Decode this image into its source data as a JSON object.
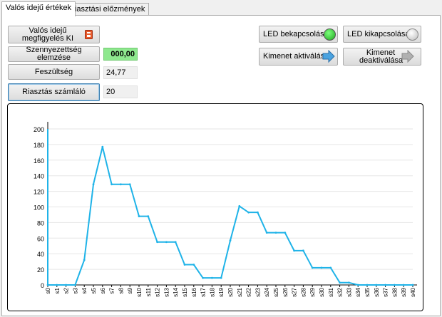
{
  "tabs": [
    {
      "label": "Valós idejű értékek",
      "active": true
    },
    {
      "label": "Riasztási előzmények",
      "active": false
    }
  ],
  "buttons": {
    "realtime_monitoring": "Valós idejű megfigyelés KI",
    "contamination_analysis": "Szennyezettség elemzése",
    "voltage": "Feszültség",
    "alarm_counter": "Riasztás számláló",
    "led_on": "LED bekapcsolása",
    "led_off": "LED kikapcsolása",
    "output_activate": "Kimenet aktiválása",
    "output_deactivate": "Kimenet deaktiválása"
  },
  "fields": {
    "contamination_value": "000,00",
    "voltage_value": "24,77",
    "alarm_count": "20"
  },
  "colors": {
    "led_on": "#22c022",
    "led_off": "#cfcfcf",
    "series": "#1fb3e8",
    "arrow_active": "#4aa3e0",
    "arrow_inactive": "#b0b0b0"
  },
  "chart_data": {
    "type": "line",
    "title": "",
    "xlabel": "",
    "ylabel": "",
    "ylim": [
      0,
      200
    ],
    "yticks": [
      0,
      20,
      40,
      60,
      80,
      100,
      120,
      140,
      160,
      180,
      200
    ],
    "grid": true,
    "categories": [
      "s0",
      "s1",
      "s2",
      "s3",
      "s4",
      "s5",
      "s6",
      "s7",
      "s8",
      "s9",
      "s10",
      "s11",
      "s12",
      "s13",
      "s14",
      "s15",
      "s16",
      "s17",
      "s18",
      "s19",
      "s20",
      "s21",
      "s22",
      "s23",
      "s24",
      "s25",
      "s26",
      "s27",
      "s28",
      "s29",
      "s30",
      "s31",
      "s32",
      "s33",
      "s34",
      "s35",
      "s36",
      "s37",
      "s38",
      "s39",
      "s40"
    ],
    "series": [
      {
        "values": [
          0,
          0,
          0,
          0,
          32,
          129,
          177,
          129,
          129,
          129,
          88,
          88,
          55,
          55,
          55,
          26,
          26,
          9,
          9,
          9,
          57,
          101,
          93,
          93,
          67,
          67,
          67,
          44,
          44,
          22,
          22,
          22,
          3,
          3,
          0,
          0,
          0,
          0,
          0,
          0,
          0
        ]
      }
    ]
  }
}
